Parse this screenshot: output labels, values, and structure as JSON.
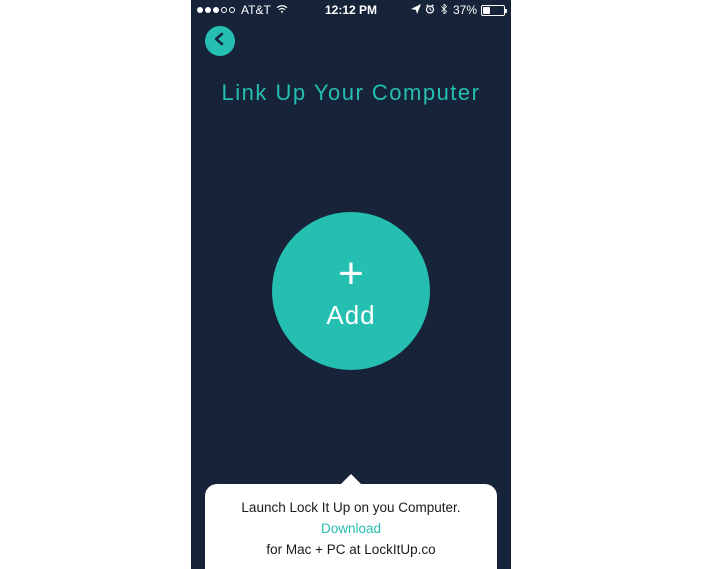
{
  "status_bar": {
    "carrier": "AT&T",
    "time": "12:12 PM",
    "battery_pct": "37%",
    "battery_level": 37
  },
  "colors": {
    "background": "#172338",
    "accent": "#25bfb1",
    "text_on_dark": "#ffffff",
    "text_on_light": "#1a1a1a"
  },
  "header": {
    "title": "Link Up Your Computer"
  },
  "add_button": {
    "icon_label": "+",
    "label": "Add"
  },
  "tooltip": {
    "line1": "Launch Lock It Up on you Computer.",
    "link_text": "Download",
    "line3": "for Mac + PC at LockItUp.co"
  }
}
